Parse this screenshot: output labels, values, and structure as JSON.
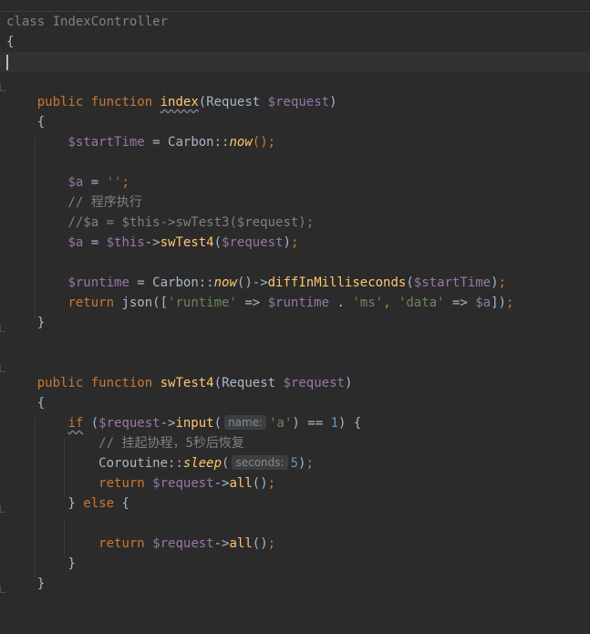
{
  "code": {
    "class_kw": "class",
    "class_name": "IndexController",
    "brace_open": "{",
    "brace_close": "}",
    "public_kw": "public",
    "function_kw": "function",
    "fn_index": "index",
    "fn_swtest4": "swTest4",
    "param_type": "Request",
    "param_var": "$request",
    "var_starttime": "$startTime",
    "carbon": "Carbon",
    "now": "now",
    "var_a": "$a",
    "empty_str": "''",
    "comment_run": "// 程序执行",
    "comment_swtest3": "//$a = $this->swTest3($request);",
    "this_var": "$this",
    "fn_swtest4_call": "swTest4",
    "var_runtime": "$runtime",
    "diff_fn": "diffInMilliseconds",
    "return_kw": "return",
    "json_fn": "json",
    "str_runtime": "'runtime'",
    "str_ms": "'ms'",
    "str_data": "'data'",
    "if_kw": "if",
    "input_fn": "input",
    "hint_name": "name:",
    "str_a": "'a'",
    "num_1": "1",
    "comment_suspend": "// 挂起协程，5秒后恢复",
    "coroutine": "Coroutine",
    "sleep_fn": "sleep",
    "hint_seconds": "seconds:",
    "num_5": "5",
    "all_fn": "all",
    "else_kw": "else"
  }
}
